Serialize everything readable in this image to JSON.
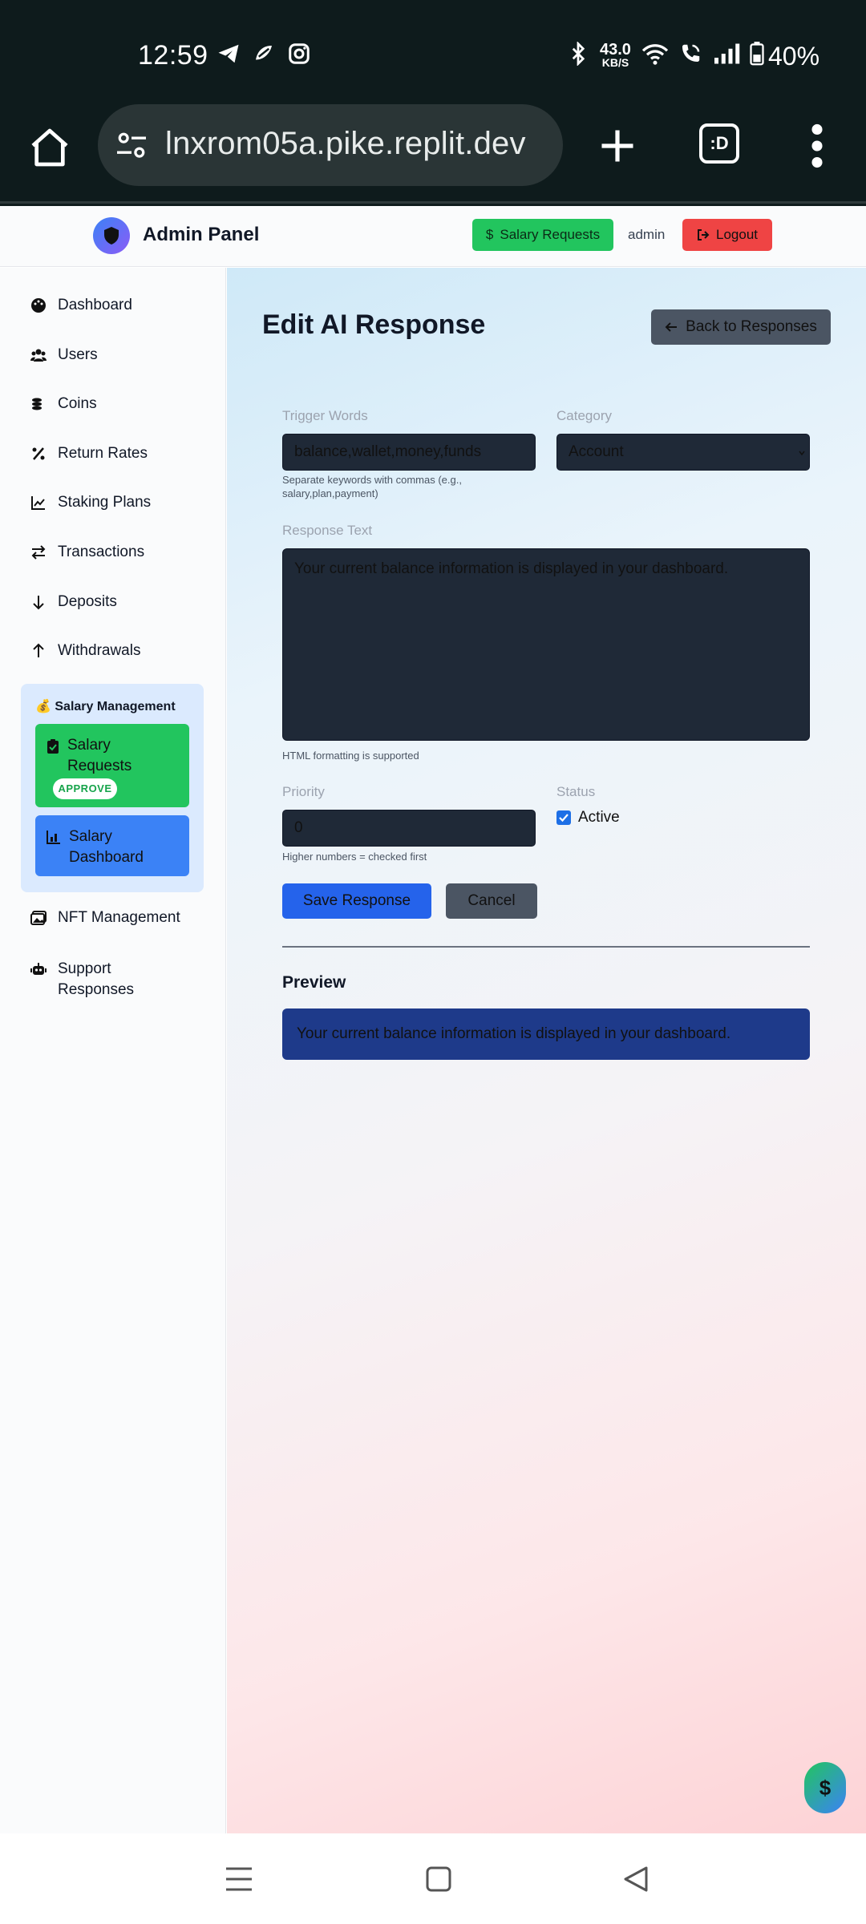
{
  "status_bar": {
    "time": "12:59",
    "net_speed_value": "43.0",
    "net_speed_unit": "KB/S",
    "battery": "40%"
  },
  "browser": {
    "url": "lnxrom05a.pike.replit.dev",
    "tab_label": ":D"
  },
  "topnav": {
    "brand": "Admin Panel",
    "salary_requests_label": "Salary Requests",
    "user": "admin",
    "logout_label": "Logout"
  },
  "sidebar": {
    "items": [
      {
        "label": "Dashboard",
        "icon": "palette-icon"
      },
      {
        "label": "Users",
        "icon": "users-icon"
      },
      {
        "label": "Coins",
        "icon": "coins-icon"
      },
      {
        "label": "Return Rates",
        "icon": "percent-icon"
      },
      {
        "label": "Staking Plans",
        "icon": "chart-line-icon"
      },
      {
        "label": "Transactions",
        "icon": "exchange-icon"
      },
      {
        "label": "Deposits",
        "icon": "arrow-down-icon"
      },
      {
        "label": "Withdrawals",
        "icon": "arrow-up-icon"
      }
    ],
    "salary_group": {
      "title": "💰 Salary Management",
      "requests_label": "Salary Requests",
      "approve_badge": "APPROVE",
      "dashboard_label": "Salary Dashboard"
    },
    "bottom_items": [
      {
        "label": "NFT Management",
        "icon": "image-icon"
      },
      {
        "label": "Support Responses",
        "icon": "robot-icon"
      }
    ]
  },
  "main": {
    "title": "Edit AI Response",
    "back_label": "Back to Responses",
    "form": {
      "trigger_label": "Trigger Words",
      "trigger_value": "balance,wallet,money,funds",
      "trigger_hint": "Separate keywords with commas (e.g., salary,plan,payment)",
      "category_label": "Category",
      "category_value": "Account",
      "response_label": "Response Text",
      "response_value": "Your current balance information is displayed in your dashboard.",
      "response_hint": "HTML formatting is supported",
      "priority_label": "Priority",
      "priority_value": "0",
      "priority_hint": "Higher numbers = checked first",
      "status_label": "Status",
      "status_text": "Active",
      "status_checked": true,
      "save_label": "Save Response",
      "cancel_label": "Cancel"
    },
    "preview": {
      "title": "Preview",
      "text": "Your current balance information is displayed in your dashboard."
    },
    "fab_symbol": "$"
  },
  "colors": {
    "green": "#22c55e",
    "red": "#ef4444",
    "blue": "#3b82f6",
    "dark_field": "#1f2937",
    "preview_bg": "#1e3a8a"
  }
}
